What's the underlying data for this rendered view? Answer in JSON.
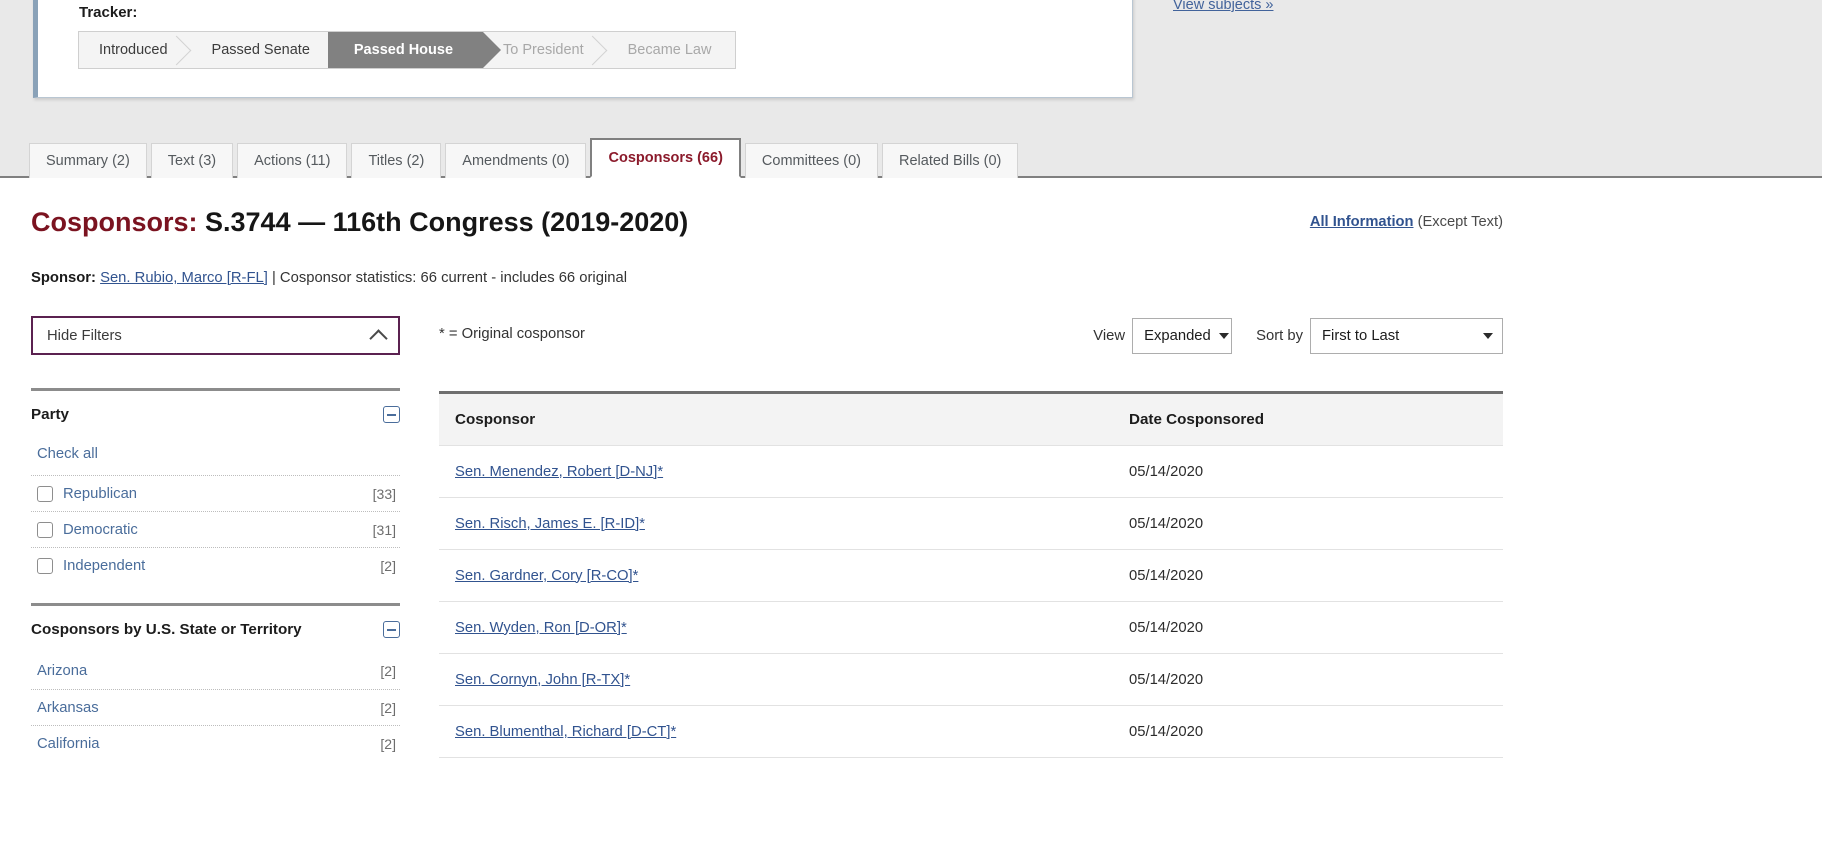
{
  "tracker": {
    "label": "Tracker:",
    "steps": [
      {
        "label": "Introduced",
        "state": "done"
      },
      {
        "label": "Passed Senate",
        "state": "done"
      },
      {
        "label": "Passed House",
        "state": "current"
      },
      {
        "label": "To President",
        "state": "future"
      },
      {
        "label": "Became Law",
        "state": "future"
      }
    ]
  },
  "view_subjects_link": "View subjects »",
  "tabs": [
    {
      "label": "Summary (2)",
      "active": false
    },
    {
      "label": "Text (3)",
      "active": false
    },
    {
      "label": "Actions (11)",
      "active": false
    },
    {
      "label": "Titles (2)",
      "active": false
    },
    {
      "label": "Amendments (0)",
      "active": false
    },
    {
      "label": "Cosponsors (66)",
      "active": true
    },
    {
      "label": "Committees (0)",
      "active": false
    },
    {
      "label": "Related Bills (0)",
      "active": false
    }
  ],
  "page": {
    "title_lead": "Cosponsors:",
    "title_rest": " S.3744 — 116th Congress (2019-2020)",
    "all_information_link": "All Information",
    "all_information_suffix": " (Except Text)"
  },
  "sponsor": {
    "label": "Sponsor:",
    "name": "Sen. Rubio, Marco [R-FL]",
    "stats": " | Cosponsor statistics: 66 current - includes 66 original"
  },
  "filters": {
    "toggle_label": "Hide Filters",
    "original_note": "* = Original cosponsor",
    "party": {
      "heading": "Party",
      "check_all": "Check all",
      "rows": [
        {
          "label": "Republican",
          "count": "[33]"
        },
        {
          "label": "Democratic",
          "count": "[31]"
        },
        {
          "label": "Independent",
          "count": "[2]"
        }
      ]
    },
    "state": {
      "heading": "Cosponsors by U.S. State or Territory",
      "rows": [
        {
          "label": "Arizona",
          "count": "[2]"
        },
        {
          "label": "Arkansas",
          "count": "[2]"
        },
        {
          "label": "California",
          "count": "[2]"
        }
      ]
    }
  },
  "controls": {
    "view_label": "View",
    "view_value": "Expanded",
    "sort_label": "Sort by",
    "sort_value": "First to Last"
  },
  "table": {
    "headers": {
      "cosponsor": "Cosponsor",
      "date": "Date Cosponsored"
    },
    "rows": [
      {
        "name": "Sen. Menendez, Robert [D-NJ]*",
        "date": "05/14/2020"
      },
      {
        "name": "Sen. Risch, James E. [R-ID]*",
        "date": "05/14/2020"
      },
      {
        "name": "Sen. Gardner, Cory [R-CO]*",
        "date": "05/14/2020"
      },
      {
        "name": "Sen. Wyden, Ron [D-OR]*",
        "date": "05/14/2020"
      },
      {
        "name": "Sen. Cornyn, John [R-TX]*",
        "date": "05/14/2020"
      },
      {
        "name": "Sen. Blumenthal, Richard [D-CT]*",
        "date": "05/14/2020"
      }
    ]
  },
  "colors": {
    "accent_maroon": "#8b1a2b",
    "link_blue": "#31538f",
    "facet_blue": "#4a6d9b",
    "filter_border_purple": "#5b2150",
    "tracker_current_gray": "#818181"
  }
}
